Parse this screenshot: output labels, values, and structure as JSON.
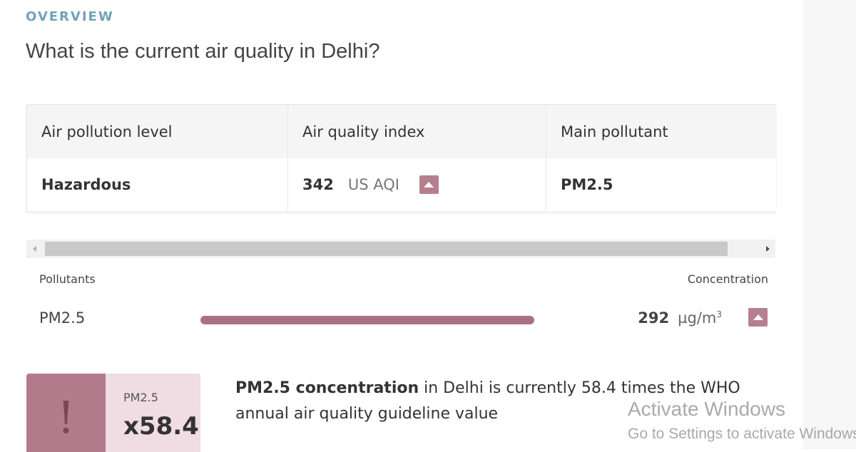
{
  "overview": {
    "eyebrow": "OVERVIEW",
    "headline": "What is the current air quality in Delhi?"
  },
  "summary_table": {
    "headers": [
      "Air pollution level",
      "Air quality index",
      "Main pollutant"
    ],
    "row": {
      "level": "Hazardous",
      "aqi_value": "342",
      "aqi_unit": "US AQI",
      "main_pollutant": "PM2.5"
    },
    "trend_icon": "triangle-up-icon"
  },
  "pollutants": {
    "col_left": "Pollutants",
    "col_right": "Concentration",
    "items": [
      {
        "name": "PM2.5",
        "value": "292",
        "unit": "µg/m",
        "unit_sup": "3",
        "bar_fraction": 1.0,
        "trend_icon": "triangle-up-icon"
      }
    ]
  },
  "who_card": {
    "icon_glyph": "!",
    "label": "PM2.5",
    "multiplier": "x58.4"
  },
  "description": {
    "bold": "PM2.5 concentration",
    "rest": " in Delhi is currently 58.4 times the WHO annual air quality guideline value"
  },
  "watermark": {
    "line1": "Activate Windows",
    "line2": "Go to Settings to activate Windows."
  },
  "colors": {
    "accent_pink": "#b57f8f",
    "bar_fill": "#a87282",
    "card_bg": "#efdde3",
    "eyebrow": "#6fa3b8"
  }
}
